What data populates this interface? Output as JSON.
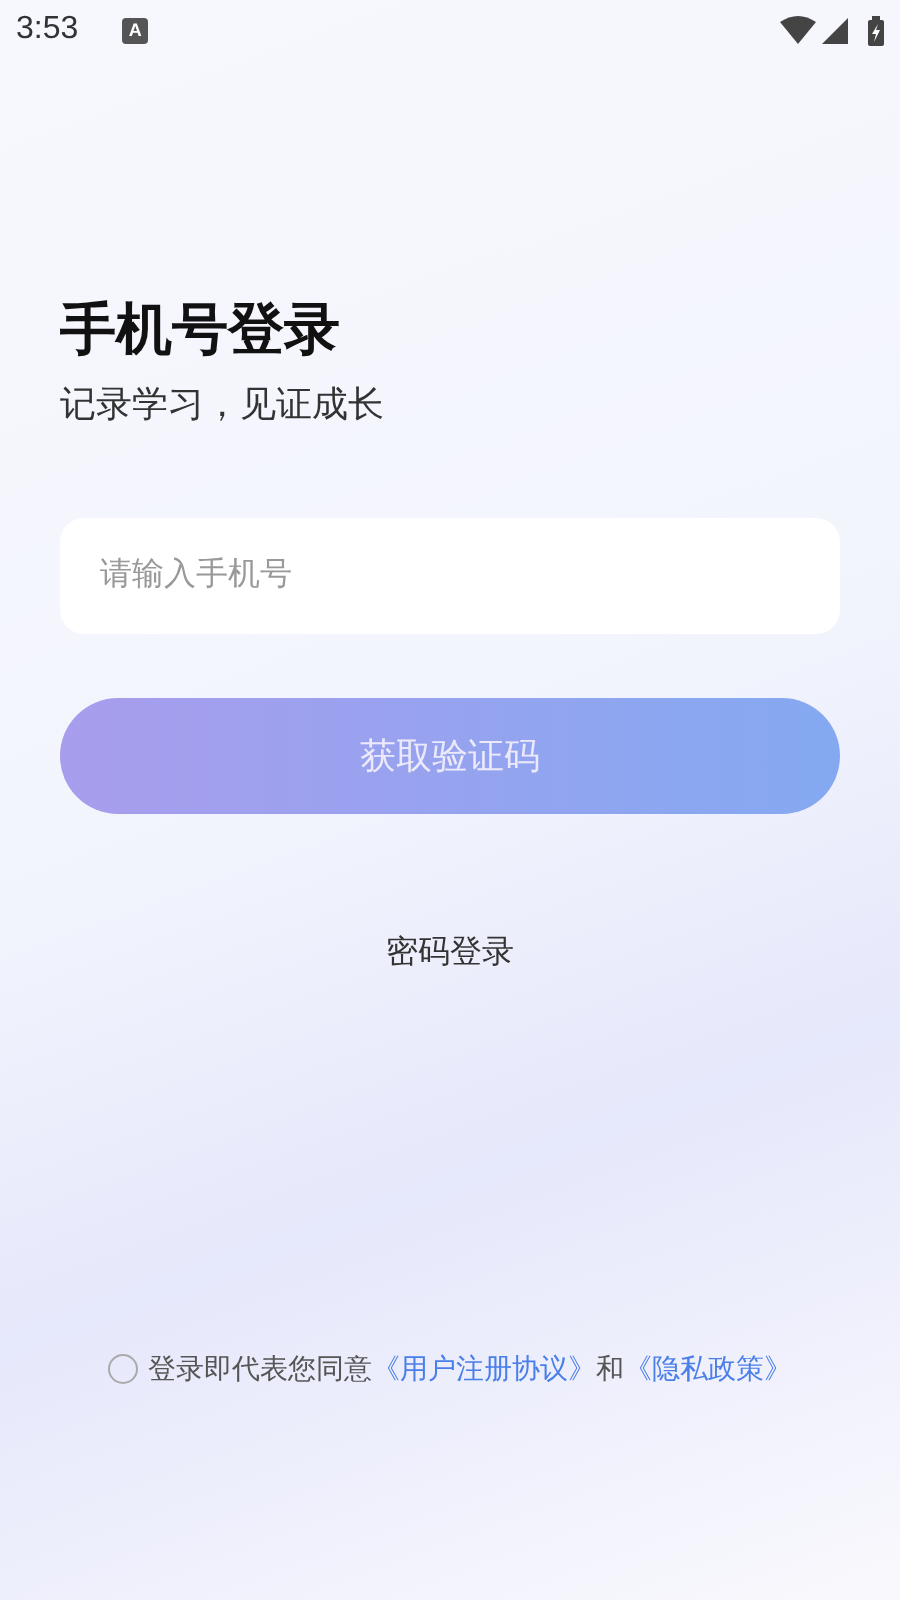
{
  "status_bar": {
    "time": "3:53",
    "notification": "A"
  },
  "title": "手机号登录",
  "subtitle": "记录学习，见证成长",
  "phone_field": {
    "placeholder": "请输入手机号"
  },
  "get_code_button": {
    "label": "获取验证码",
    "disabled": true
  },
  "password_login_link": "密码登录",
  "agreement": {
    "checked": false,
    "text": "登录即代表您同意",
    "terms_link": "《用户注册协议》",
    "conjunction": "和",
    "privacy_link": "《隐私政策》"
  }
}
